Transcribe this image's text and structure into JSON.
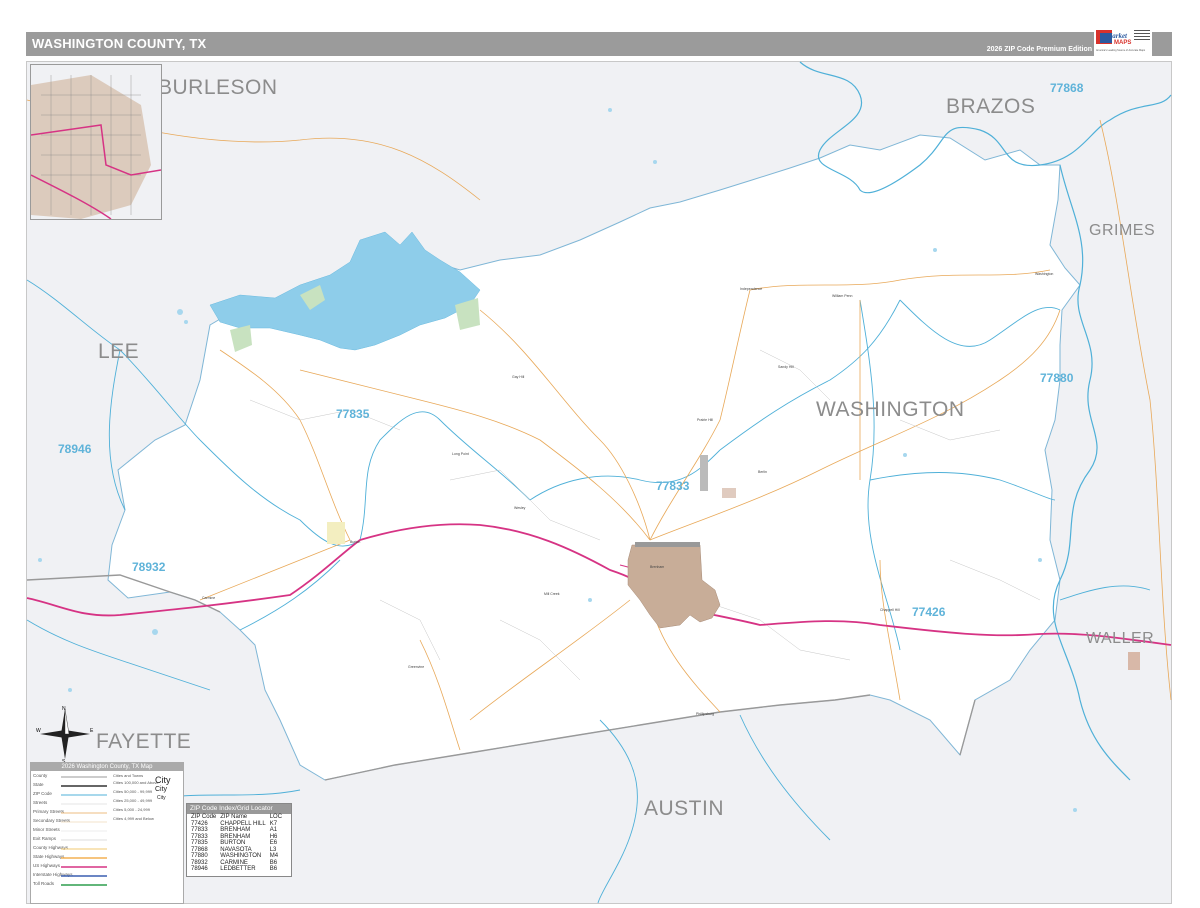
{
  "header": {
    "title": "WASHINGTON COUNTY, TX",
    "edition": "2026 ZIP Code Premium Edition"
  },
  "logo": {
    "brand_top": "Market",
    "brand_bottom": "MAPS",
    "tagline": "America's Leading Source of Accurate Maps"
  },
  "counties": {
    "burleson": "BURLESON",
    "brazos": "BRAZOS",
    "grimes": "GRIMES",
    "lee": "LEE",
    "washington": "WASHINGTON",
    "fayette": "FAYETTE",
    "austin": "AUSTIN",
    "waller": "WALLER"
  },
  "zips": {
    "z77868": "77868",
    "z77835": "77835",
    "z77880": "77880",
    "z78946": "78946",
    "z77833": "77833",
    "z78932": "78932",
    "z77426": "77426"
  },
  "towns": {
    "chappell_hill": "Chappell Hill",
    "brenham": "Brenham",
    "burton": "Burton",
    "washington": "Washington",
    "independence": "Independence",
    "william_penn": "William Penn",
    "gay_hill": "Gay Hill",
    "long_point": "Long Point",
    "wesley": "Wesley",
    "phillipsburg": "Phillipsburg",
    "mill_creek": "Mill Creek",
    "greenvine": "Greenvine",
    "carmine": "Carmine",
    "prairie_hill": "Prairie Hill",
    "berlin": "Berlin",
    "sandy_hill": "Sandy Hill"
  },
  "legend": {
    "title": "2026 Washington County, TX Map",
    "rows": [
      "County",
      "State",
      "ZIP Code",
      "Streets",
      "Primary Streets",
      "Secondary Streets",
      "Minor Streets",
      "Exit Ramps",
      "County Highways",
      "State Highways",
      "US Highways",
      "Interstate Highways",
      "Toll Roads"
    ],
    "city_header": "Cities and Towns",
    "cities": [
      "Cities 100,000 and Above",
      "Cities 50,000 - 99,999",
      "Cities 25,000 - 49,999",
      "Cities 5,000 - 24,999",
      "Cities 4,999 and Below"
    ],
    "city_big": "City",
    "city_mid": "City",
    "city_small": "City"
  },
  "zip_index": {
    "title": "ZIP Code Index/Grid Locator",
    "headers": [
      "ZIP Code",
      "ZIP Name",
      "LOC"
    ],
    "rows": [
      [
        "77426",
        "CHAPPELL HILL",
        "K7"
      ],
      [
        "77833",
        "BRENHAM",
        "A1"
      ],
      [
        "77833",
        "BRENHAM",
        "H6"
      ],
      [
        "77835",
        "BURTON",
        "E6"
      ],
      [
        "77868",
        "NAVASOTA",
        "L3"
      ],
      [
        "77880",
        "WASHINGTON",
        "M4"
      ],
      [
        "78932",
        "CARMINE",
        "B6"
      ],
      [
        "78946",
        "LEDBETTER",
        "B6"
      ]
    ]
  },
  "compass": {
    "n": "N",
    "s": "S",
    "e": "E",
    "w": "W"
  },
  "colors": {
    "county_fill": "#ffffff",
    "outside_fill": "#f0f1f4",
    "zip_line": "#4fb0d8",
    "highway": "#d63384",
    "road": "#e8a858",
    "lake": "#8ecdea",
    "city": "#c8ad98"
  }
}
